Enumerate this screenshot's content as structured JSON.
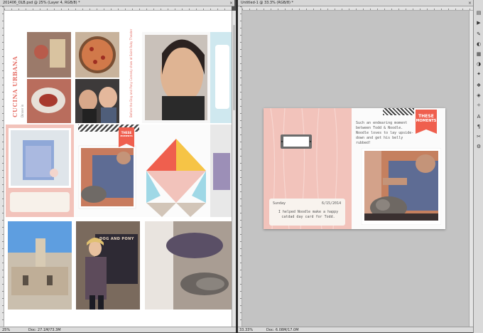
{
  "left_window": {
    "tab_title": "201406_OLB.psd @ 25% (Layer 4, RGB/8) *",
    "zoom": "25%",
    "doc_info": "Doc: 27.1M/73.3M"
  },
  "right_window": {
    "tab_title": "Untitled-1 @ 33.3% (RGB/8) *",
    "zoom": "33.33%",
    "doc_info": "Doc: 6.08M/17.0M"
  },
  "layout_card": {
    "vertical_title": "CUCINA URBANA",
    "vertical_small": "Dinner in",
    "caption_text": "Before the Dog and Pony Comedy show at Saint Ruby Theater"
  },
  "these_moments_tag": {
    "line1": "THESE",
    "line2": "MOMENTS"
  },
  "journal_card": {
    "day": "Sunday",
    "date": "6/15/2014",
    "text": "I helped Noodle make a happy catdad day card for Todd."
  },
  "right_journal": {
    "text": "Such an endearing moment between Todd & Noodle. Noodle loves to lay upside-down and get his belly rubbed!"
  },
  "poster_text": "DOG AND PONY",
  "colors": {
    "pink": "#f2c3bb",
    "coral": "#ef5f4e",
    "yellow": "#f6c446",
    "aqua": "#9fd8e6",
    "panel": "#535353"
  },
  "tools": [
    "history-icon",
    "actions-icon",
    "brush-icon",
    "color-icon",
    "swatches-icon",
    "adjust-icon",
    "styles-icon",
    "layers-icon",
    "channels-icon",
    "paths-icon",
    "character-icon",
    "paragraph-icon",
    "tools-icon",
    "properties-icon"
  ]
}
